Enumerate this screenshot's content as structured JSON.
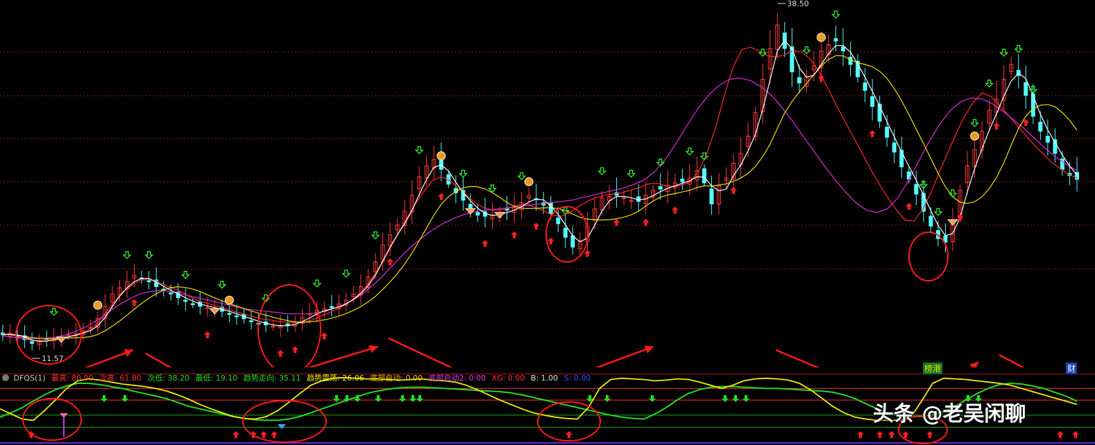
{
  "chart_data": [
    {
      "type": "candlestick",
      "title": "",
      "price_labels": {
        "high": "38.50",
        "low": "11.57"
      },
      "series": [
        {
          "name": "close",
          "values": [
            12.3,
            12.4,
            12.1,
            11.9,
            11.6,
            11.8,
            11.9,
            12.0,
            12.1,
            12.3,
            12.4,
            12.6,
            12.9,
            13.6,
            14.6,
            15.6,
            16.1,
            16.6,
            17.1,
            16.9,
            16.6,
            16.2,
            15.9,
            15.6,
            15.3,
            15.0,
            14.8,
            14.6,
            14.5,
            14.4,
            14.2,
            14.0,
            13.8,
            13.6,
            13.4,
            13.2,
            13.1,
            13.0,
            13.0,
            13.1,
            13.3,
            13.7,
            14.0,
            14.3,
            14.4,
            14.5,
            14.8,
            15.1,
            15.6,
            16.2,
            17.0,
            18.2,
            19.6,
            20.4,
            21.2,
            22.3,
            23.6,
            25.1,
            26.0,
            26.5,
            25.7,
            24.5,
            23.8,
            23.2,
            22.5,
            22.0,
            21.9,
            22.0,
            22.2,
            22.4,
            22.6,
            23.0,
            23.6,
            23.3,
            22.8,
            22.1,
            21.3,
            20.2,
            19.4,
            19.9,
            21.1,
            22.5,
            23.4,
            23.5,
            23.6,
            23.4,
            23.2,
            23.1,
            23.6,
            24.0,
            24.1,
            24.4,
            24.6,
            24.7,
            25.0,
            25.6,
            24.6,
            22.9,
            24.4,
            25.0,
            26.2,
            27.0,
            28.4,
            30.3,
            33.0,
            35.5,
            37.4,
            35.5,
            33.6,
            32.7,
            33.2,
            34.1,
            35.3,
            35.8,
            36.1,
            35.3,
            34.2,
            33.2,
            32.1,
            30.8,
            29.6,
            28.3,
            27.1,
            25.9,
            24.9,
            23.7,
            22.3,
            21.1,
            20.1,
            19.8,
            21.6,
            24.0,
            26.0,
            27.3,
            28.8,
            30.5,
            31.4,
            33.0,
            34.2,
            33.3,
            31.7,
            30.0,
            28.8,
            27.9,
            27.0,
            25.7,
            25.2,
            24.9
          ]
        },
        {
          "name": "MA-red",
          "values": [
            12.4,
            12.3,
            12.1,
            11.9,
            11.8,
            11.9,
            11.9,
            12.0,
            12.2,
            12.4,
            12.7,
            13.2,
            14.1,
            15.0,
            15.8,
            16.3,
            16.7,
            16.8,
            16.6,
            16.3,
            16.0,
            15.7,
            15.3,
            15.0,
            14.8,
            14.6,
            14.4,
            14.2,
            14.0,
            13.8,
            13.6,
            13.5,
            13.4,
            13.3,
            13.3,
            13.3,
            13.5,
            13.8,
            14.1,
            14.4,
            14.8,
            15.3,
            16.0,
            16.9,
            18.0,
            19.2,
            20.5,
            21.7,
            22.9,
            23.9,
            24.8,
            25.1,
            24.8,
            24.2,
            23.6,
            23.0,
            22.6,
            22.4,
            22.4,
            22.6,
            22.8,
            22.9,
            22.6,
            22.3,
            22.0,
            21.9,
            22.2,
            22.7,
            23.1,
            23.4,
            23.6,
            23.7,
            23.8,
            24.0,
            24.2,
            24.5,
            24.6,
            24.4,
            24.3,
            24.4,
            24.7,
            25.6,
            27.1,
            29.2,
            31.8,
            34.0,
            35.4,
            35.6,
            35.3,
            34.9,
            34.8,
            35.0,
            35.3,
            35.2,
            34.6,
            33.6,
            32.3,
            30.9,
            29.6,
            28.3,
            27.0,
            25.7,
            24.5,
            23.4,
            22.4,
            21.6,
            21.5,
            22.4,
            23.8,
            25.5,
            27.1,
            28.7,
            30.1,
            31.2,
            31.9,
            31.6,
            30.9,
            30.1,
            29.3,
            28.5,
            27.7,
            27.0,
            26.3,
            25.8,
            25.3,
            25.0
          ]
        },
        {
          "name": "MA-magenta",
          "values": [
            12.2,
            12.1,
            12.0,
            12.0,
            12.0,
            12.1,
            12.3,
            12.6,
            13.0,
            13.5,
            14.1,
            14.7,
            15.2,
            15.6,
            15.8,
            15.9,
            15.8,
            15.6,
            15.4,
            15.2,
            15.0,
            14.8,
            14.6,
            14.4,
            14.3,
            14.2,
            14.1,
            14.0,
            14.0,
            14.0,
            14.1,
            14.3,
            14.6,
            15.0,
            15.5,
            16.2,
            17.0,
            17.9,
            18.8,
            19.6,
            20.3,
            20.9,
            21.4,
            21.8,
            22.1,
            22.3,
            22.4,
            22.5,
            22.6,
            22.7,
            22.8,
            22.9,
            23.0,
            23.1,
            23.2,
            23.4,
            23.6,
            23.8,
            24.0,
            24.2,
            24.5,
            24.9,
            25.6,
            26.6,
            27.9,
            29.3,
            30.6,
            31.7,
            32.5,
            33.0,
            33.1,
            32.9,
            32.4,
            31.7,
            30.7,
            29.6,
            28.4,
            27.2,
            26.0,
            24.9,
            23.9,
            23.0,
            22.4,
            22.2,
            22.5,
            23.4,
            24.8,
            26.4,
            28.0,
            29.4,
            30.5,
            31.2,
            31.5,
            31.4,
            31.0,
            30.4,
            29.7,
            29.0,
            28.2,
            27.4,
            26.7,
            26.1,
            25.6
          ]
        }
      ],
      "markers": {
        "up_arrow_count": 22,
        "down_arrow_count": 30,
        "money_bag_count": 6,
        "diamond_count": 5
      }
    },
    {
      "type": "line",
      "title": "DFQS(1)",
      "reference_lines": [
        80.0,
        61.8,
        38.2,
        19.1
      ],
      "series": [
        {
          "name": "趋势走向",
          "values": [
            35,
            42,
            50,
            60,
            70,
            78,
            84,
            88,
            88,
            86,
            83,
            80,
            76,
            72,
            68,
            64,
            58,
            52,
            48,
            44,
            40,
            36,
            33,
            31,
            30,
            30,
            32,
            36,
            42,
            48,
            54,
            60,
            66,
            72,
            76,
            79,
            81,
            82,
            82,
            81,
            80,
            79,
            78,
            77,
            76,
            75,
            73,
            70,
            66,
            62,
            58,
            54,
            50,
            46,
            42,
            38,
            35,
            33,
            32,
            40,
            50,
            62,
            72,
            78,
            82,
            83,
            83,
            82,
            81,
            80,
            80,
            79,
            78,
            77,
            76,
            74,
            70,
            64,
            56,
            48,
            42,
            38,
            36,
            36,
            38,
            44,
            52,
            62,
            72,
            80,
            86,
            88,
            87,
            84,
            80,
            74,
            68,
            60
          ]
        },
        {
          "name": "趋势震荡",
          "values": [
            48,
            40,
            32,
            30,
            45,
            62,
            80,
            92,
            95,
            93,
            90,
            87,
            85,
            83,
            80,
            76,
            70,
            63,
            55,
            48,
            42,
            36,
            33,
            32,
            36,
            45,
            58,
            72,
            85,
            92,
            96,
            97,
            96,
            95,
            95,
            94,
            93,
            94,
            95,
            93,
            92,
            90,
            85,
            78,
            70,
            62,
            55,
            48,
            42,
            38,
            35,
            33,
            32,
            50,
            80,
            94,
            96,
            95,
            94,
            92,
            93,
            95,
            94,
            90,
            85,
            80,
            85,
            92,
            95,
            96,
            95,
            93,
            88,
            78,
            65,
            52,
            42,
            35,
            32,
            30,
            30,
            30,
            34,
            60,
            88,
            96,
            95,
            94,
            92,
            90,
            88,
            85,
            80,
            75,
            70,
            65,
            60,
            55
          ]
        }
      ],
      "legend": [
        {
          "label": "DFQS(1)"
        },
        {
          "label": "最高: 80.00"
        },
        {
          "label": "次高: 61.80"
        },
        {
          "label": "次低: 38.20"
        },
        {
          "label": "最低: 19.10"
        },
        {
          "label": "趋势走向: 35.11"
        },
        {
          "label": "趋势震荡: 26.06"
        },
        {
          "label": "底部启动: 0.00"
        },
        {
          "label": "底部启动2: 0.00"
        },
        {
          "label": "XG: 0.00"
        },
        {
          "label": "B: 1.00"
        },
        {
          "label": "S: 0.00"
        }
      ]
    }
  ],
  "colors": {
    "background": "#000000",
    "grid_dotted": "#8b1a1a",
    "candle_up": "#ff3b3b",
    "candle_down": "#54ffff",
    "ma_red": "#ff2a2a",
    "ma_magenta": "#e02ce0",
    "ma_yellow": "#f0e000",
    "ma_white": "#ffffff",
    "osc_green": "#22dd22",
    "osc_yellow": "#f0f000",
    "annotation": "#ff1a1a"
  },
  "tags": {
    "bang_gang": "榜港",
    "cai": "财"
  },
  "watermark": "头条 @老吴闲聊"
}
